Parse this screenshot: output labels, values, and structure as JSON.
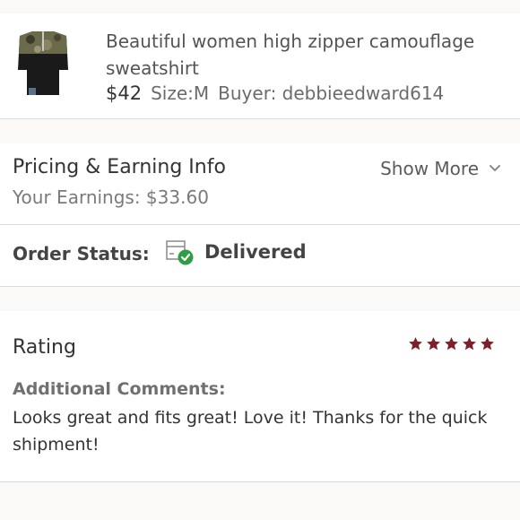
{
  "item": {
    "title": "Beautiful women high zipper camouflage sweatshirt",
    "price": "$42",
    "size": "Size:M",
    "buyer": "Buyer: debbieedward614"
  },
  "pricing": {
    "title": "Pricing & Earning Info",
    "show_more": "Show More",
    "earnings": "Your Earnings: $33.60"
  },
  "order_status": {
    "label": "Order Status:",
    "value": "Delivered",
    "icon": "box-check-icon",
    "check_color": "#2f9e45"
  },
  "rating": {
    "title": "Rating",
    "stars": 5,
    "max_stars": 5,
    "star_color": "#7f1f2a",
    "comments_label": "Additional Comments:",
    "comments": "Looks great and fits great! Love it! Thanks for the quick shipment!"
  }
}
